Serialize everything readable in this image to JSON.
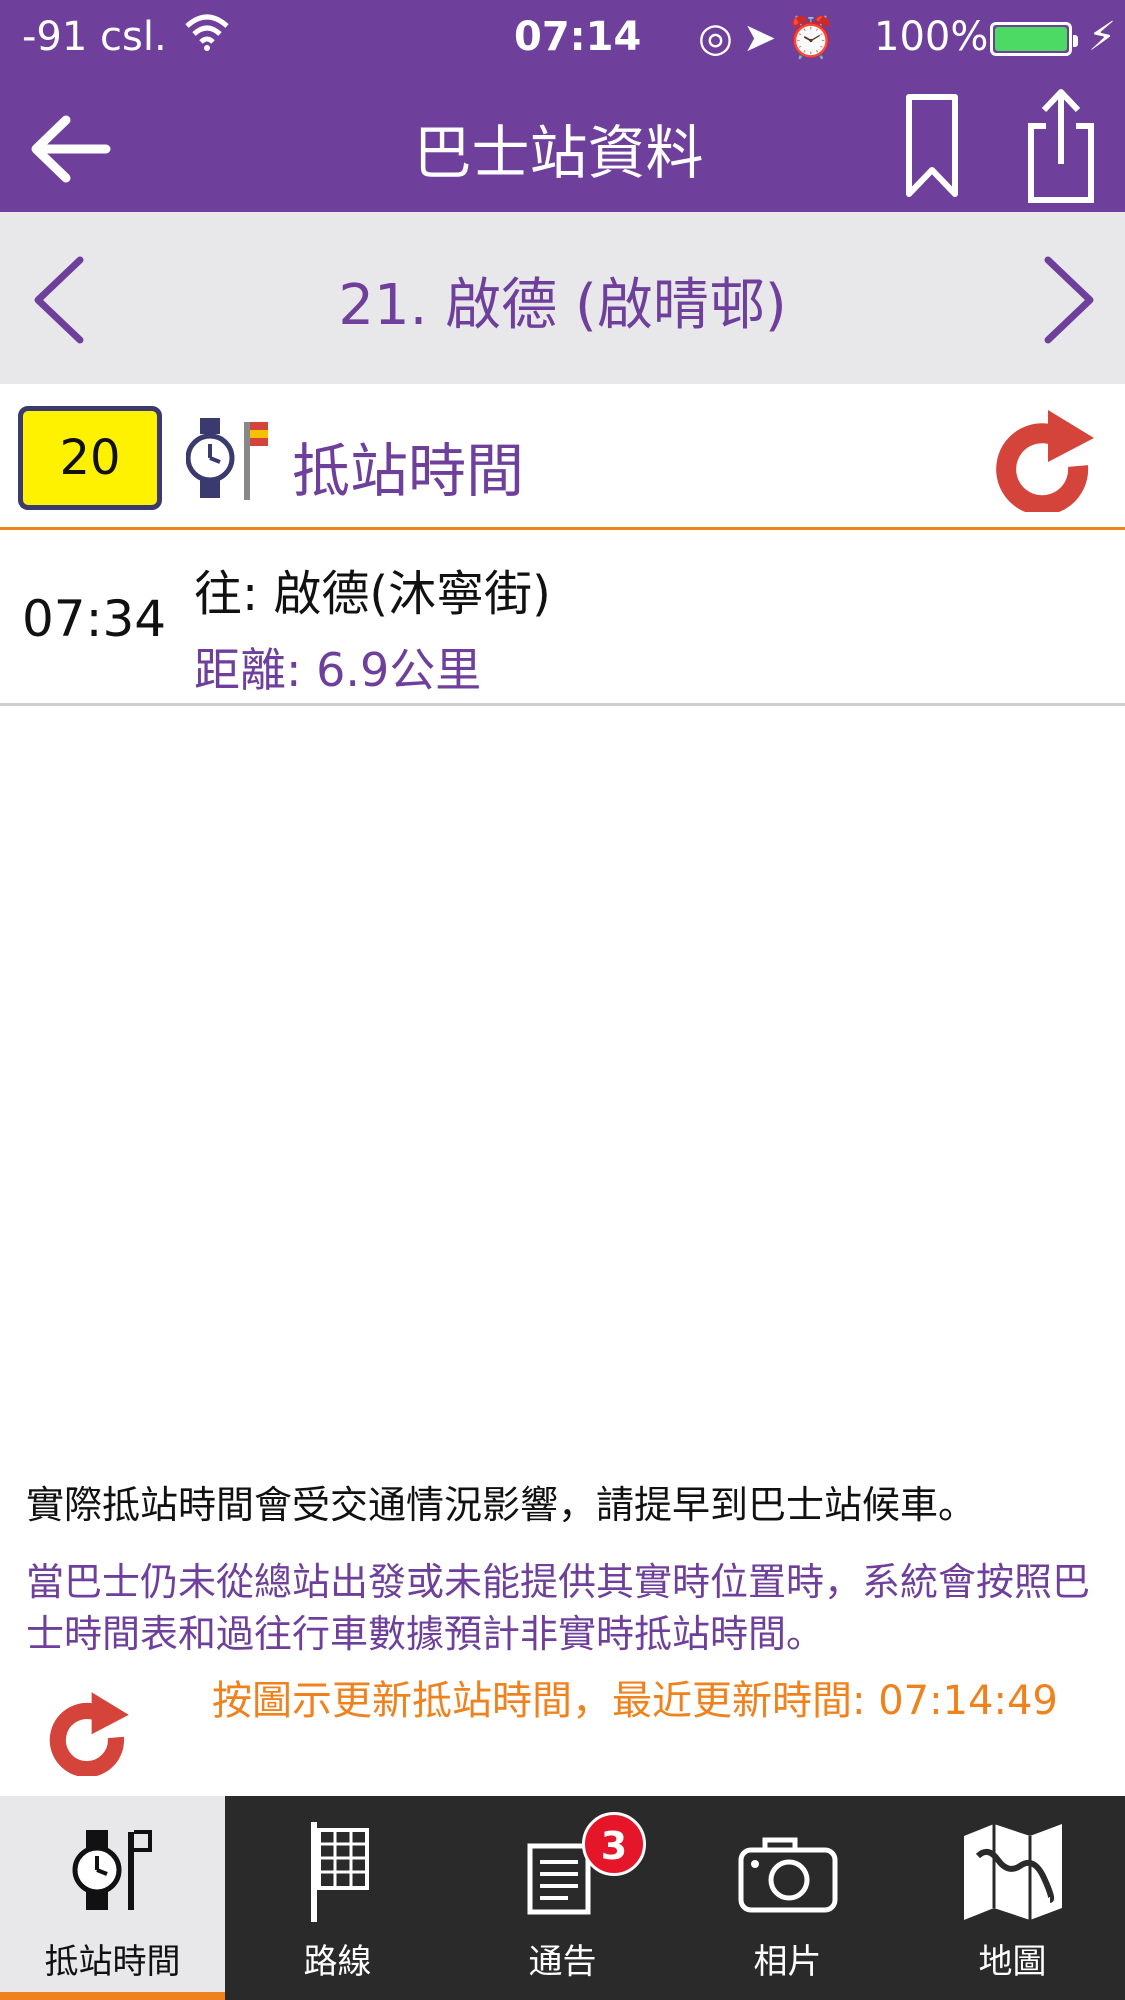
{
  "status_bar": {
    "carrier": "-91 csl.",
    "time": "07:14",
    "battery": "100%"
  },
  "nav": {
    "title": "巴士站資料"
  },
  "stop": {
    "name": "21. 啟德 (啟晴邨)"
  },
  "arrival": {
    "route": "20",
    "title": "抵站時間"
  },
  "eta": {
    "time": "07:34",
    "destination": "往: 啟德(沐寧街)",
    "distance": "距離: 6.9公里"
  },
  "notes": {
    "traffic": "實際抵站時間會受交通情況影響，請提早到巴士站候車。",
    "schedule": "當巴士仍未從總站出發或未能提供其實時位置時，系統會按照巴士時間表和過往行車數據預計非實時抵站時間。",
    "update": "按圖示更新抵站時間，最近更新時間: 07:14:49"
  },
  "tabs": [
    {
      "label": "抵站時間",
      "icon": "clock-flag-icon",
      "active": true
    },
    {
      "label": "路線",
      "icon": "route-board-icon",
      "active": false
    },
    {
      "label": "通告",
      "icon": "notice-icon",
      "active": false,
      "badge": "3"
    },
    {
      "label": "相片",
      "icon": "camera-icon",
      "active": false
    },
    {
      "label": "地圖",
      "icon": "map-icon",
      "active": false
    }
  ],
  "colors": {
    "brand_purple": "#6f3f9c",
    "accent_orange": "#f0821e",
    "route_yellow": "#fff200",
    "refresh_red": "#d5443a",
    "badge_red": "#e5162a"
  }
}
